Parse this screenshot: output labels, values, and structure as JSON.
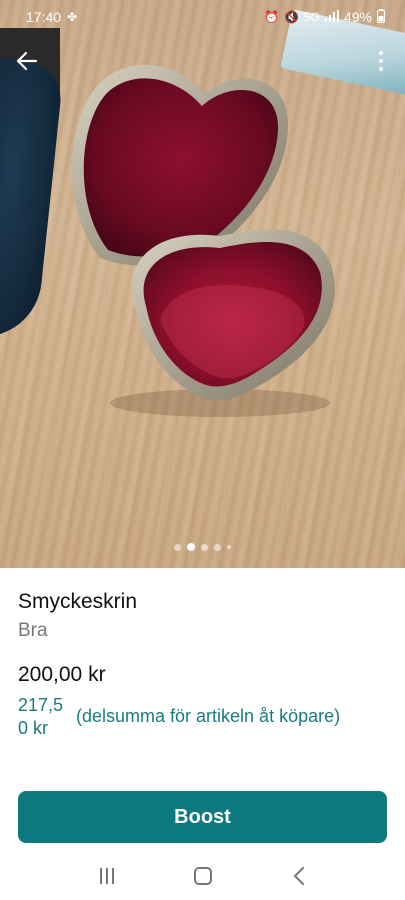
{
  "status_bar": {
    "time": "17:40",
    "network": "5G",
    "battery": "49%"
  },
  "gallery": {
    "image_count": 5,
    "active_index": 1
  },
  "listing": {
    "title": "Smyckeskrin",
    "condition": "Bra",
    "price": "200,00 kr",
    "buyer_total": "217,5\n0 kr",
    "buyer_total_note": "(delsumma för artikeln åt köpare)"
  },
  "actions": {
    "boost_label": "Boost"
  },
  "colors": {
    "accent": "#0e7a80",
    "accent_text": "#1a7b80",
    "muted_text": "#777777"
  },
  "icons": [
    "back-arrow-icon",
    "more-vertical-icon",
    "alarm-icon",
    "signal-icon",
    "battery-icon",
    "recents-icon",
    "home-icon",
    "back-nav-icon"
  ]
}
